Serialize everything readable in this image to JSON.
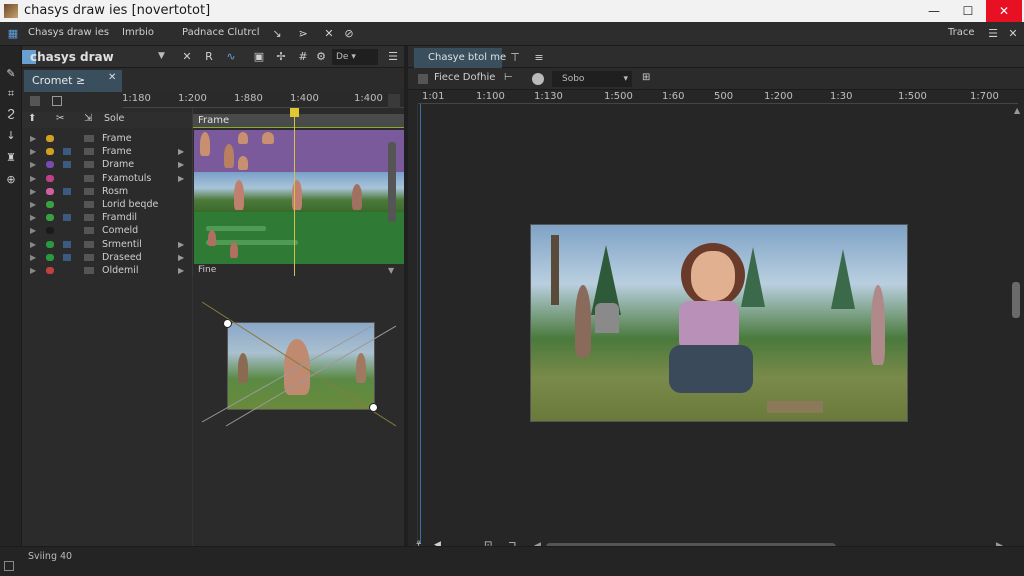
{
  "app": {
    "title": "chasys draw ies [novertotot]",
    "window_buttons": {
      "minimize": "—",
      "maximize": "☐",
      "close": "✕"
    }
  },
  "menubar": {
    "items": [
      "Chasys draw ies",
      "Imrbio",
      "Padnace Clutrcl"
    ],
    "right_label": "Trace",
    "right_menu": "☰"
  },
  "left_panel": {
    "title": "chasys draw",
    "tab": "Cromet ≥",
    "tab_close": "✕",
    "ruler": [
      "1:180",
      "1:200",
      "1:880",
      "1:400",
      "1:400"
    ],
    "layer_header": {
      "col_label": "Sole"
    },
    "layers": [
      {
        "label": "Frame",
        "dot": "#d4a020"
      },
      {
        "label": "Frame",
        "dot": "#d4a020"
      },
      {
        "label": "Drame",
        "dot": "#7a4ab0"
      },
      {
        "label": "Fxamotuls",
        "dot": "#c0408a"
      },
      {
        "label": "Rosm",
        "dot": "#d060a0"
      },
      {
        "label": "Lorid beqde",
        "dot": "#3aa040"
      },
      {
        "label": "Framdil",
        "dot": "#3aa040"
      },
      {
        "label": "Comeld",
        "dot": "#1a1a1a"
      },
      {
        "label": "Srmentil",
        "dot": "#2a9a40"
      },
      {
        "label": "Draseed",
        "dot": "#2a9a40"
      },
      {
        "label": "Oldemil",
        "dot": "#c04040"
      }
    ],
    "timeline_header": "Frame",
    "track_footer": "Fine"
  },
  "right_panel": {
    "tab": "Chasye btol me",
    "tab_extra": "⊤",
    "toolbar_label": "Fiece Dofhie",
    "dropdown_value": "Sobo",
    "ruler": [
      "1:01",
      "1:100",
      "1:130",
      "1:500",
      "1:60",
      "500",
      "1:200",
      "1:30",
      "1:500",
      "1:700"
    ]
  },
  "statusbar": {
    "left": "Sviing 40"
  },
  "colors": {
    "accent": "#3a4f5e",
    "playhead": "#d4c14a",
    "close": "#e81123"
  }
}
